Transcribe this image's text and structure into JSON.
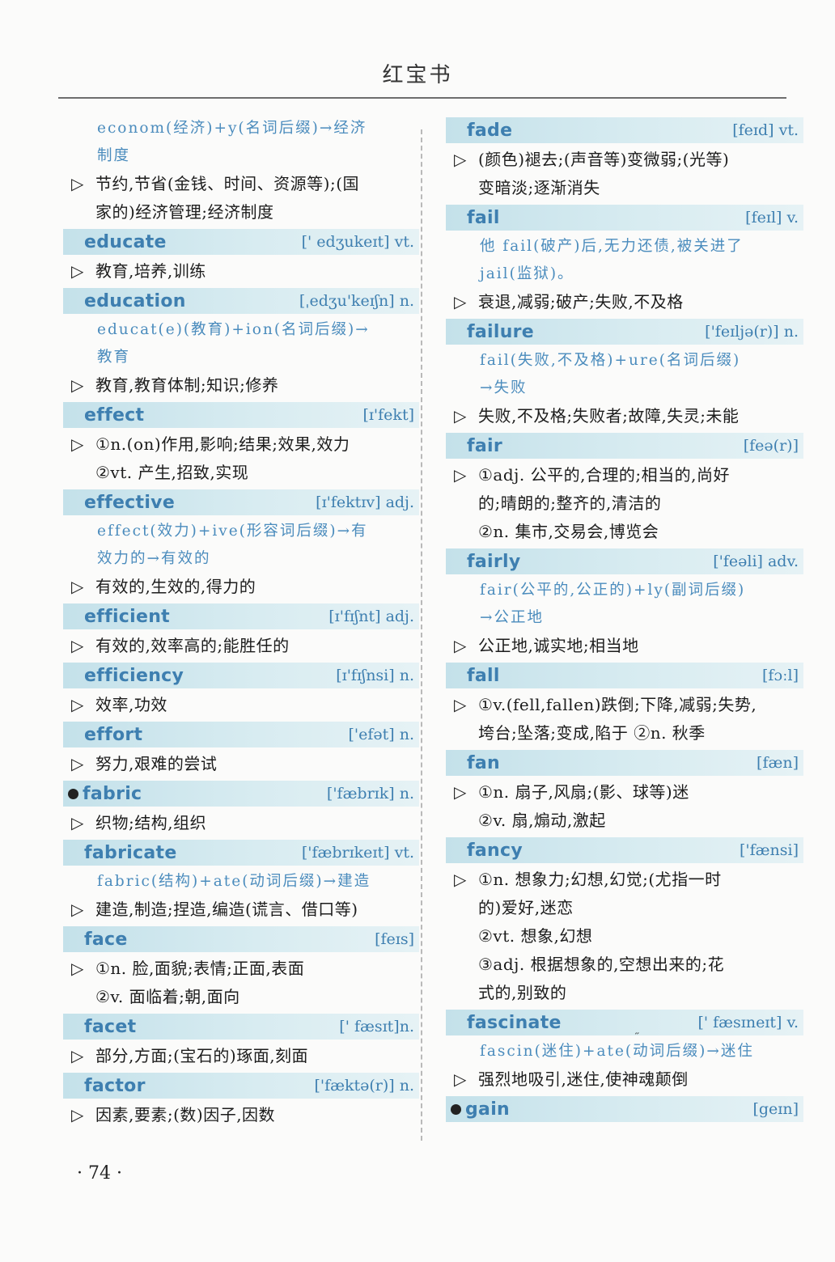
{
  "page": {
    "header": "红宝书",
    "footer": "· 74 ·"
  },
  "left": {
    "lines": [
      {
        "kind": "note",
        "text": "econom(经济)+y(名词后缀)→经济"
      },
      {
        "kind": "note",
        "text": "制度"
      },
      {
        "kind": "def",
        "text": "节约,节省(金钱、时间、资源等);(国"
      },
      {
        "kind": "defc",
        "text": "家的)经济管理;经济制度"
      },
      {
        "kind": "head",
        "word": "educate",
        "phon": "[' edʒukeɪt] vt."
      },
      {
        "kind": "def",
        "text": "教育,培养,训练"
      },
      {
        "kind": "head",
        "word": "education",
        "phon": "[ˌedʒu'keɪʃn] n."
      },
      {
        "kind": "note",
        "text": "educat(e)(教育)+ion(名词后缀)→"
      },
      {
        "kind": "note",
        "text": "教育"
      },
      {
        "kind": "def",
        "text": "教育,教育体制;知识;修养"
      },
      {
        "kind": "head",
        "word": "effect",
        "phon": "[ɪ'fekt]"
      },
      {
        "kind": "def",
        "text": "①n.(on)作用,影响;结果;效果,效力"
      },
      {
        "kind": "defc",
        "text": "②vt. 产生,招致,实现"
      },
      {
        "kind": "head",
        "word": "effective",
        "phon": "[ɪ'fektɪv] adj."
      },
      {
        "kind": "note",
        "text": "effect(效力)+ive(形容词后缀)→有"
      },
      {
        "kind": "note",
        "text": "效力的→有效的"
      },
      {
        "kind": "def",
        "text": "有效的,生效的,得力的"
      },
      {
        "kind": "head",
        "word": "efficient",
        "phon": "[ɪ'fɪʃnt] adj."
      },
      {
        "kind": "def",
        "text": "有效的,效率高的;能胜任的"
      },
      {
        "kind": "head",
        "word": "efficiency",
        "phon": "[ɪ'fɪʃnsi] n."
      },
      {
        "kind": "def",
        "text": "效率,功效"
      },
      {
        "kind": "head",
        "word": "effort",
        "phon": "['efət] n."
      },
      {
        "kind": "def",
        "text": "努力,艰难的尝试"
      },
      {
        "kind": "head",
        "word": "fabric",
        "phon": "['fæbrɪk] n.",
        "star": true
      },
      {
        "kind": "def",
        "text": "织物;结构,组织"
      },
      {
        "kind": "head",
        "word": "fabricate",
        "phon": "['fæbrɪkeɪt] vt."
      },
      {
        "kind": "note",
        "text": "fabric(结构)+ate(动词后缀)→建造"
      },
      {
        "kind": "def",
        "text": "建造,制造;捏造,编造(谎言、借口等)"
      },
      {
        "kind": "head",
        "word": "face",
        "phon": "[feɪs]"
      },
      {
        "kind": "def",
        "text": "①n. 脸,面貌;表情;正面,表面"
      },
      {
        "kind": "defc",
        "text": "②v. 面临着;朝,面向"
      },
      {
        "kind": "head",
        "word": "facet",
        "phon": "[' fæsɪt]n."
      },
      {
        "kind": "def",
        "text": "部分,方面;(宝石的)琢面,刻面"
      },
      {
        "kind": "head",
        "word": "factor",
        "phon": "['fæktə(r)] n."
      },
      {
        "kind": "def",
        "text": "因素,要素;(数)因子,因数"
      }
    ]
  },
  "right": {
    "lines": [
      {
        "kind": "head",
        "word": "fade",
        "phon": "[feɪd] vt."
      },
      {
        "kind": "def",
        "text": "(颜色)褪去;(声音等)变微弱;(光等)"
      },
      {
        "kind": "defc",
        "text": "变暗淡;逐渐消失"
      },
      {
        "kind": "head",
        "word": "fail",
        "phon": "[feɪl] v."
      },
      {
        "kind": "note",
        "text": "他 fail(破产)后,无力还债,被关进了"
      },
      {
        "kind": "note",
        "text": "jail(监狱)。"
      },
      {
        "kind": "def",
        "text": "衰退,减弱;破产;失败,不及格"
      },
      {
        "kind": "head",
        "word": "failure",
        "phon": "['feɪljə(r)] n."
      },
      {
        "kind": "note",
        "text": "fail(失败,不及格)+ure(名词后缀)"
      },
      {
        "kind": "note",
        "text": "→失败"
      },
      {
        "kind": "def",
        "text": "失败,不及格;失败者;故障,失灵;未能"
      },
      {
        "kind": "head",
        "word": "fair",
        "phon": "[feə(r)]"
      },
      {
        "kind": "def",
        "text": "①adj. 公平的,合理的;相当的,尚好"
      },
      {
        "kind": "defc",
        "text": "的;晴朗的;整齐的,清洁的"
      },
      {
        "kind": "defc",
        "text": "②n. 集市,交易会,博览会"
      },
      {
        "kind": "head",
        "word": "fairly",
        "phon": "['feəli] adv."
      },
      {
        "kind": "note",
        "text": "fair(公平的,公正的)+ly(副词后缀)"
      },
      {
        "kind": "note",
        "text": "→公正地"
      },
      {
        "kind": "def",
        "text": "公正地,诚实地;相当地"
      },
      {
        "kind": "head",
        "word": "fall",
        "phon": "[fɔːl]"
      },
      {
        "kind": "def",
        "text": "①v.(fell,fallen)跌倒;下降,减弱;失势,"
      },
      {
        "kind": "defc",
        "text": "垮台;坠落;变成,陷于 ②n. 秋季"
      },
      {
        "kind": "head",
        "word": "fan",
        "phon": "[fæn]"
      },
      {
        "kind": "def",
        "text": "①n. 扇子,风扇;(影、球等)迷"
      },
      {
        "kind": "defc",
        "text": "②v. 扇,煽动,激起"
      },
      {
        "kind": "head",
        "word": "fancy",
        "phon": "['fænsi]"
      },
      {
        "kind": "def",
        "text": "①n. 想象力;幻想,幻觉;(尤指一时"
      },
      {
        "kind": "defc",
        "text": "的)爱好,迷恋"
      },
      {
        "kind": "defc",
        "text": "②vt. 想象,幻想"
      },
      {
        "kind": "defc",
        "text": "③adj. 根据想象的,空想出来的;花"
      },
      {
        "kind": "defc",
        "text": "式的,别致的"
      },
      {
        "kind": "head",
        "word": "fascinate",
        "phon": "[' fæsɪneɪt] v."
      },
      {
        "kind": "note",
        "text": "fascin(迷住)+ate(动词后缀)→迷住"
      },
      {
        "kind": "def",
        "text": "强烈地吸引,迷住,使神魂颠倒"
      },
      {
        "kind": "head",
        "word": "gain",
        "phon": "[geɪn]",
        "star": true
      }
    ]
  },
  "colors": {
    "headword": "#3e7fb0",
    "note": "#4b8cbd",
    "band": "#c4e1ea"
  }
}
